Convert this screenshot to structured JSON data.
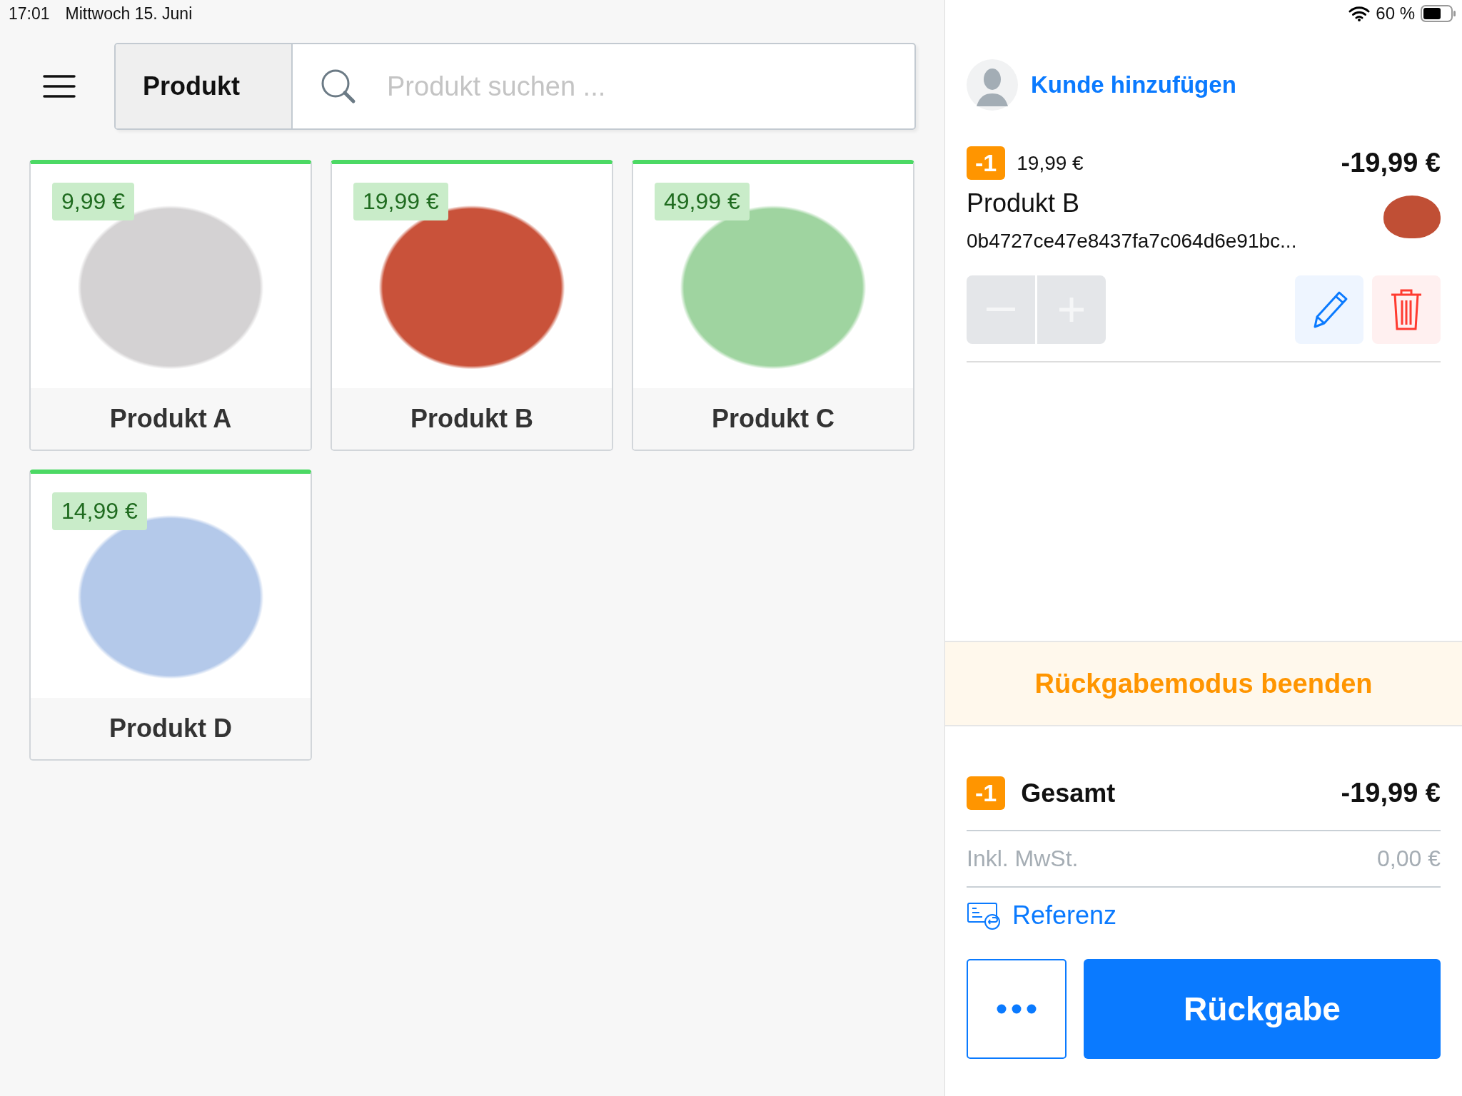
{
  "status_bar": {
    "time": "17:01",
    "date": "Mittwoch 15. Juni",
    "battery": "60 %"
  },
  "search": {
    "category": "Produkt",
    "placeholder": "Produkt suchen ..."
  },
  "products": [
    {
      "name": "Produkt A",
      "price": "9,99 €",
      "kind": "pillow"
    },
    {
      "name": "Produkt B",
      "price": "19,99 €",
      "kind": "teapot"
    },
    {
      "name": "Produkt C",
      "price": "49,99 €",
      "kind": "bag"
    },
    {
      "name": "Produkt D",
      "price": "14,99 €",
      "kind": "hoodie"
    }
  ],
  "customer": {
    "label": "Kunde hinzufügen"
  },
  "cart_item": {
    "quantity": "-1",
    "unit_price": "19,99 €",
    "total": "-19,99 €",
    "name": "Produkt B",
    "code": "0b4727ce47e8437fa7c064d6e91bc...",
    "stepper_disabled": true
  },
  "return_mode": {
    "label": "Rückgabemodus beenden"
  },
  "summary": {
    "quantity": "-1",
    "label": "Gesamt",
    "total": "-19,99 €",
    "tax_label": "Inkl. MwSt.",
    "tax_value": "0,00 €",
    "reference": "Referenz"
  },
  "actions": {
    "primary": "Rückgabe"
  }
}
